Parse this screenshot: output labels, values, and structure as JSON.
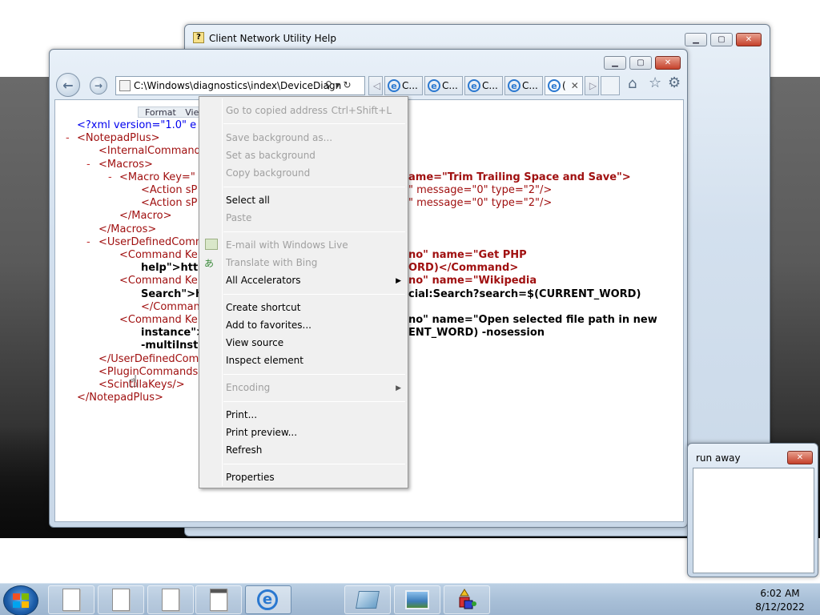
{
  "help_window": {
    "title": "Client Network Utility Help"
  },
  "ie": {
    "address": "C:\\Windows\\diagnostics\\index\\DeviceDiagn",
    "tabs": [
      {
        "label": "C..."
      },
      {
        "label": "C..."
      },
      {
        "label": "C..."
      },
      {
        "label": "C..."
      },
      {
        "label": "("
      }
    ],
    "toolbar_fragment": {
      "format": "Format",
      "view": "Vie"
    }
  },
  "xml": {
    "lines": [
      "<?xml version=\"1.0\" e",
      "<NotepadPlus>",
      "<InternalCommand",
      "<Macros>",
      "<Macro Key=\"",
      "ame=\"Trim Trailing Space and Save\">",
      "<Action sP",
      "\" message=\"0\" type=\"2\"/>",
      "<Action sP",
      "\" message=\"0\" type=\"2\"/>",
      "</Macro>",
      "</Macros>",
      "<UserDefinedComm",
      "<Command Ke",
      "no\" name=\"Get PHP",
      "help\">http",
      "ORD)</Command>",
      "<Command Ke",
      "no\" name=\"Wikipedia",
      "Search\">h",
      "cial:Search?search=$(CURRENT_WORD)",
      "</Comman",
      "<Command Ke",
      "no\" name=\"Open selected file path in new",
      "instance\">",
      "ENT_WORD) -nosession",
      "-multiInst",
      "</UserDefinedCom",
      "<PluginCommands",
      "<ScintillaKeys/>",
      "</NotepadPlus>"
    ]
  },
  "context_menu": {
    "items": [
      {
        "label": "Go to copied address",
        "shortcut": "Ctrl+Shift+L",
        "disabled": true
      },
      {
        "label": "Save background as...",
        "disabled": true
      },
      {
        "label": "Set as background",
        "disabled": true
      },
      {
        "label": "Copy background",
        "disabled": true
      },
      {
        "label": "Select all",
        "disabled": false
      },
      {
        "label": "Paste",
        "disabled": true
      },
      {
        "label": "E-mail with Windows Live",
        "disabled": true
      },
      {
        "label": "Translate with Bing",
        "disabled": true
      },
      {
        "label": "All Accelerators",
        "disabled": false
      },
      {
        "label": "Create shortcut",
        "disabled": false
      },
      {
        "label": "Add to favorites...",
        "disabled": false
      },
      {
        "label": "View source",
        "disabled": false
      },
      {
        "label": "Inspect element",
        "disabled": false
      },
      {
        "label": "Encoding",
        "disabled": true
      },
      {
        "label": "Print...",
        "disabled": false
      },
      {
        "label": "Print preview...",
        "disabled": false
      },
      {
        "label": "Refresh",
        "disabled": false
      },
      {
        "label": "Properties",
        "disabled": false
      }
    ]
  },
  "run_away": {
    "title": "run away"
  },
  "taskbar": {
    "time": "6:02 AM",
    "date": "8/12/2022"
  },
  "icons": {
    "back": "back-arrow-icon",
    "forward": "forward-arrow-icon",
    "home": "home-icon",
    "favorites": "star-icon",
    "tools": "gear-icon"
  },
  "colors": {
    "xml_blue": "#0000ee",
    "xml_red": "#a01010",
    "close_red": "#c5412b"
  }
}
